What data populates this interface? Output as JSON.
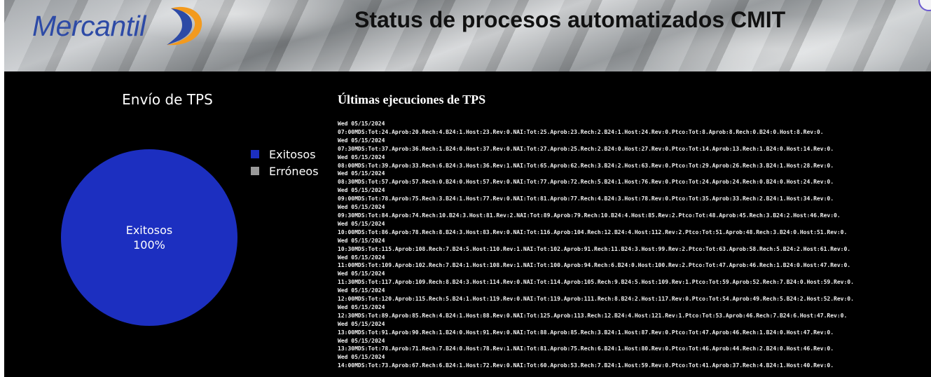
{
  "header": {
    "logo_text": "Mercantil",
    "title": "Status de procesos automatizados CMIT"
  },
  "colors": {
    "exitosos": "#1c2fc0",
    "erroneos": "#9a9a9a",
    "panel_bg": "#000000",
    "logo_blue": "#2d4aa6",
    "logo_orange": "#f39a1e"
  },
  "chart_panel": {
    "title": "Envío de TPS",
    "legend": [
      {
        "label": "Exitosos",
        "color": "#1c2fc0"
      },
      {
        "label": "Erróneos",
        "color": "#9a9a9a"
      }
    ],
    "slice_label": "Exitosos",
    "slice_percent": "100%"
  },
  "chart_data": {
    "type": "pie",
    "title": "Envío de TPS",
    "categories": [
      "Exitosos",
      "Erróneos"
    ],
    "values": [
      100,
      0
    ],
    "legend_position": "right"
  },
  "log_panel": {
    "title": "Últimas ejecuciones de TPS",
    "entries": [
      {
        "date": "Wed 05/15/2024",
        "line": "07:00MDS:Tot:24.Aprob:20.Rech:4.B24:1.Host:23.Rev:0.NAI:Tot:25.Aprob:23.Rech:2.B24:1.Host:24.Rev:0.Ptco:Tot:8.Aprob:8.Rech:0.B24:0.Host:8.Rev:0."
      },
      {
        "date": "Wed 05/15/2024",
        "line": "07:30MDS:Tot:37.Aprob:36.Rech:1.B24:0.Host:37.Rev:0.NAI:Tot:27.Aprob:25.Rech:2.B24:0.Host:27.Rev:0.Ptco:Tot:14.Aprob:13.Rech:1.B24:0.Host:14.Rev:0."
      },
      {
        "date": "Wed 05/15/2024",
        "line": "08:00MDS:Tot:39.Aprob:33.Rech:6.B24:3.Host:36.Rev:1.NAI:Tot:65.Aprob:62.Rech:3.B24:2.Host:63.Rev:0.Ptco:Tot:29.Aprob:26.Rech:3.B24:1.Host:28.Rev:0."
      },
      {
        "date": "Wed 05/15/2024",
        "line": "08:30MDS:Tot:57.Aprob:57.Rech:0.B24:0.Host:57.Rev:0.NAI:Tot:77.Aprob:72.Rech:5.B24:1.Host:76.Rev:0.Ptco:Tot:24.Aprob:24.Rech:0.B24:0.Host:24.Rev:0."
      },
      {
        "date": "Wed 05/15/2024",
        "line": "09:00MDS:Tot:78.Aprob:75.Rech:3.B24:1.Host:77.Rev:0.NAI:Tot:81.Aprob:77.Rech:4.B24:3.Host:78.Rev:0.Ptco:Tot:35.Aprob:33.Rech:2.B24:1.Host:34.Rev:0."
      },
      {
        "date": "Wed 05/15/2024",
        "line": "09:30MDS:Tot:84.Aprob:74.Rech:10.B24:3.Host:81.Rev:2.NAI:Tot:89.Aprob:79.Rech:10.B24:4.Host:85.Rev:2.Ptco:Tot:48.Aprob:45.Rech:3.B24:2.Host:46.Rev:0."
      },
      {
        "date": "Wed 05/15/2024",
        "line": "10:00MDS:Tot:86.Aprob:78.Rech:8.B24:3.Host:83.Rev:0.NAI:Tot:116.Aprob:104.Rech:12.B24:4.Host:112.Rev:2.Ptco:Tot:51.Aprob:48.Rech:3.B24:0.Host:51.Rev:0."
      },
      {
        "date": "Wed 05/15/2024",
        "line": "10:30MDS:Tot:115.Aprob:108.Rech:7.B24:5.Host:110.Rev:1.NAI:Tot:102.Aprob:91.Rech:11.B24:3.Host:99.Rev:2.Ptco:Tot:63.Aprob:58.Rech:5.B24:2.Host:61.Rev:0."
      },
      {
        "date": "Wed 05/15/2024",
        "line": "11:00MDS:Tot:109.Aprob:102.Rech:7.B24:1.Host:108.Rev:1.NAI:Tot:100.Aprob:94.Rech:6.B24:0.Host:100.Rev:2.Ptco:Tot:47.Aprob:46.Rech:1.B24:0.Host:47.Rev:0."
      },
      {
        "date": "Wed 05/15/2024",
        "line": "11:30MDS:Tot:117.Aprob:109.Rech:8.B24:3.Host:114.Rev:0.NAI:Tot:114.Aprob:105.Rech:9.B24:5.Host:109.Rev:1.Ptco:Tot:59.Aprob:52.Rech:7.B24:0.Host:59.Rev:0."
      },
      {
        "date": "Wed 05/15/2024",
        "line": "12:00MDS:Tot:120.Aprob:115.Rech:5.B24:1.Host:119.Rev:0.NAI:Tot:119.Aprob:111.Rech:8.B24:2.Host:117.Rev:0.Ptco:Tot:54.Aprob:49.Rech:5.B24:2.Host:52.Rev:0."
      },
      {
        "date": "Wed 05/15/2024",
        "line": "12:30MDS:Tot:89.Aprob:85.Rech:4.B24:1.Host:88.Rev:0.NAI:Tot:125.Aprob:113.Rech:12.B24:4.Host:121.Rev:1.Ptco:Tot:53.Aprob:46.Rech:7.B24:6.Host:47.Rev:0."
      },
      {
        "date": "Wed 05/15/2024",
        "line": "13:00MDS:Tot:91.Aprob:90.Rech:1.B24:0.Host:91.Rev:0.NAI:Tot:88.Aprob:85.Rech:3.B24:1.Host:87.Rev:0.Ptco:Tot:47.Aprob:46.Rech:1.B24:0.Host:47.Rev:0."
      },
      {
        "date": "Wed 05/15/2024",
        "line": "13:30MDS:Tot:78.Aprob:71.Rech:7.B24:0.Host:78.Rev:1.NAI:Tot:81.Aprob:75.Rech:6.B24:1.Host:80.Rev:0.Ptco:Tot:46.Aprob:44.Rech:2.B24:0.Host:46.Rev:0."
      },
      {
        "date": "Wed 05/15/2024",
        "line": "14:00MDS:Tot:73.Aprob:67.Rech:6.B24:1.Host:72.Rev:0.NAI:Tot:60.Aprob:53.Rech:7.B24:1.Host:59.Rev:0.Ptco:Tot:41.Aprob:37.Rech:4.B24:1.Host:40.Rev:0."
      }
    ]
  }
}
